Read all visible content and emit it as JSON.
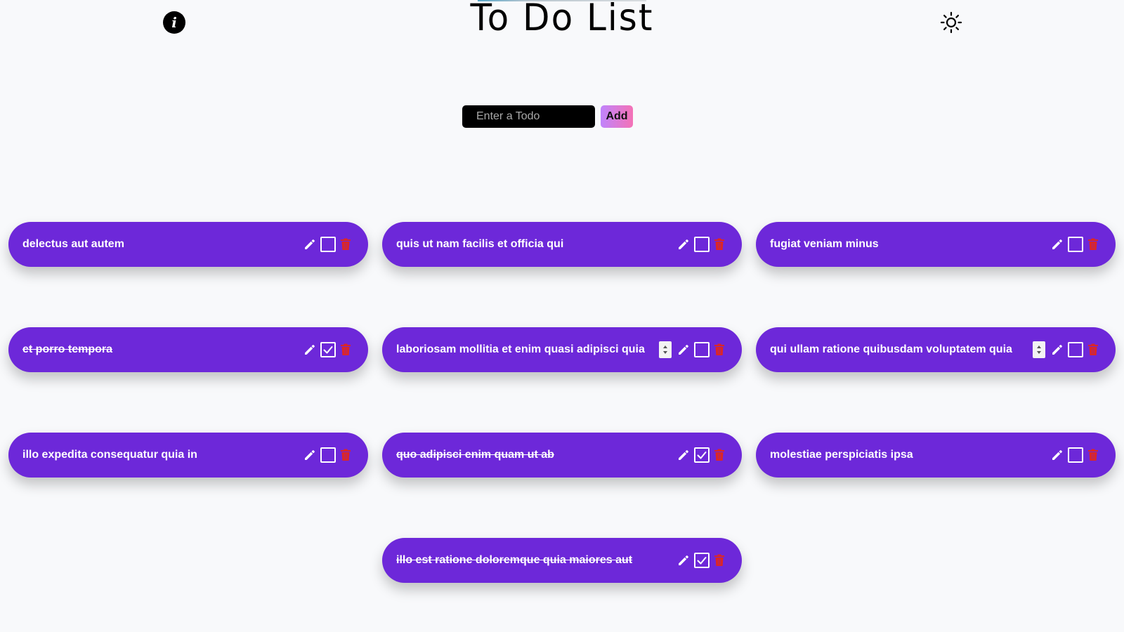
{
  "header": {
    "title": "To Do List",
    "info_icon": "info-icon",
    "theme_icon": "sun-icon"
  },
  "form": {
    "placeholder": "Enter a Todo",
    "add_label": "Add"
  },
  "colors": {
    "card": "#6d28d9",
    "delete": "#dc2626",
    "background": "#f8f9fb"
  },
  "todos": [
    {
      "text": "delectus aut autem",
      "done": false,
      "spinner": false
    },
    {
      "text": "quis ut nam facilis et officia qui",
      "done": false,
      "spinner": false
    },
    {
      "text": "fugiat veniam minus",
      "done": false,
      "spinner": false
    },
    {
      "text": "et porro tempora",
      "done": true,
      "spinner": false
    },
    {
      "text": "laboriosam mollitia et enim quasi adipisci quia",
      "done": false,
      "spinner": true
    },
    {
      "text": "qui ullam ratione quibusdam voluptatem quia",
      "done": false,
      "spinner": true
    },
    {
      "text": "illo expedita consequatur quia in",
      "done": false,
      "spinner": false
    },
    {
      "text": "quo adipisci enim quam ut ab",
      "done": true,
      "spinner": false
    },
    {
      "text": "molestiae perspiciatis ipsa",
      "done": false,
      "spinner": false
    },
    {
      "text": "illo est ratione doloremque quia maiores aut",
      "done": true,
      "spinner": false
    }
  ]
}
